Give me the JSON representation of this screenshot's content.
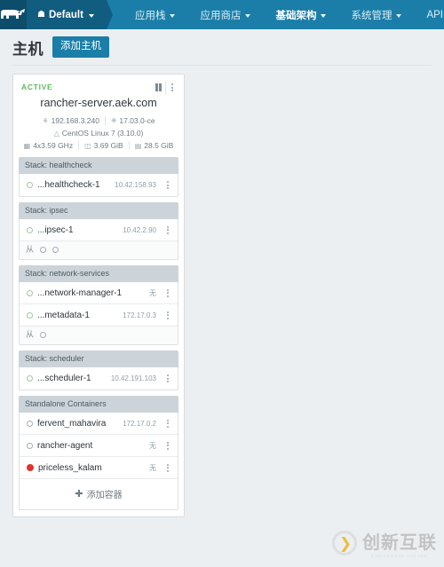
{
  "navbar": {
    "logo_icon": "rancher-cow-logo",
    "environment": {
      "icon": "home-icon",
      "label": "Default",
      "caret": "chevron-down-icon"
    },
    "items": [
      {
        "label": "应用栈",
        "active": false
      },
      {
        "label": "应用商店",
        "active": false
      },
      {
        "label": "基础架构",
        "active": true
      },
      {
        "label": "系统管理",
        "active": false
      },
      {
        "label": "API",
        "active": false
      }
    ]
  },
  "page": {
    "title": "主机",
    "add_host_button": "添加主机"
  },
  "host": {
    "state": "ACTIVE",
    "pause_icon": "pause-icon",
    "menu_icon": "kebab-menu-icon",
    "name": "rancher-server.aek.com",
    "ip": "192.168.3.240",
    "docker_version": "17.03.0-ce",
    "os": "CentOS Linux 7 (3.10.0)",
    "cpu": "4x3.59 GHz",
    "memory": "3.69 GiB",
    "disk": "28.5 GiB",
    "ip_icon": "link-icon",
    "docker_icon": "docker-whale-icon",
    "os_icon": "centos-icon",
    "cpu_icon": "cpu-icon",
    "mem_icon": "memory-icon",
    "disk_icon": "disk-icon"
  },
  "stacks": [
    {
      "header": "Stack: healthcheck",
      "rows": [
        {
          "status": "ring-green",
          "name": "...healthcheck-1",
          "ip": "10.42.158.93",
          "menu": "kebab-menu-icon"
        }
      ],
      "sidekicks": null
    },
    {
      "header": "Stack: ipsec",
      "rows": [
        {
          "status": "ring-green",
          "name": "...ipsec-1",
          "ip": "10.42.2.90",
          "menu": "kebab-menu-icon"
        }
      ],
      "sidekicks": {
        "glyph": "从",
        "count": 2
      }
    },
    {
      "header": "Stack: network-services",
      "rows": [
        {
          "status": "ring-green",
          "name": "...network-manager-1",
          "ip": "无",
          "menu": "kebab-menu-icon"
        },
        {
          "status": "ring-green",
          "name": "...metadata-1",
          "ip": "172.17.0.3",
          "menu": "kebab-menu-icon"
        }
      ],
      "sidekicks": {
        "glyph": "从",
        "count": 1
      }
    },
    {
      "header": "Stack: scheduler",
      "rows": [
        {
          "status": "ring-green",
          "name": "...scheduler-1",
          "ip": "10.42.191.103",
          "menu": "kebab-menu-icon"
        }
      ],
      "sidekicks": null
    }
  ],
  "standalone": {
    "header": "Standalone Containers",
    "rows": [
      {
        "status": "ring-grey",
        "name": "fervent_mahavira",
        "ip": "172.17.0.2",
        "menu": "kebab-menu-icon"
      },
      {
        "status": "ring-grey",
        "name": "rancher-agent",
        "ip": "无",
        "menu": "kebab-menu-icon"
      },
      {
        "status": "solid-red",
        "name": "priceless_kalam",
        "ip": "无",
        "menu": "kebab-menu-icon"
      }
    ],
    "add_label": "添加容器",
    "add_icon": "plus-icon"
  },
  "watermark": {
    "mark_icon": "cx-circle-logo",
    "text": "创新互联",
    "subtext": "CHUANGXIN HULIAN"
  },
  "colors": {
    "nav_bg": "#1b7ea8",
    "nav_env_bg": "#105d80",
    "logo_bg": "#0c4d6b",
    "accent": "#1b7ea8",
    "active_green": "#5eb85e",
    "error_red": "#e0342b",
    "page_bg": "#eceff1",
    "stack_head_bg": "#ccd4d9"
  }
}
